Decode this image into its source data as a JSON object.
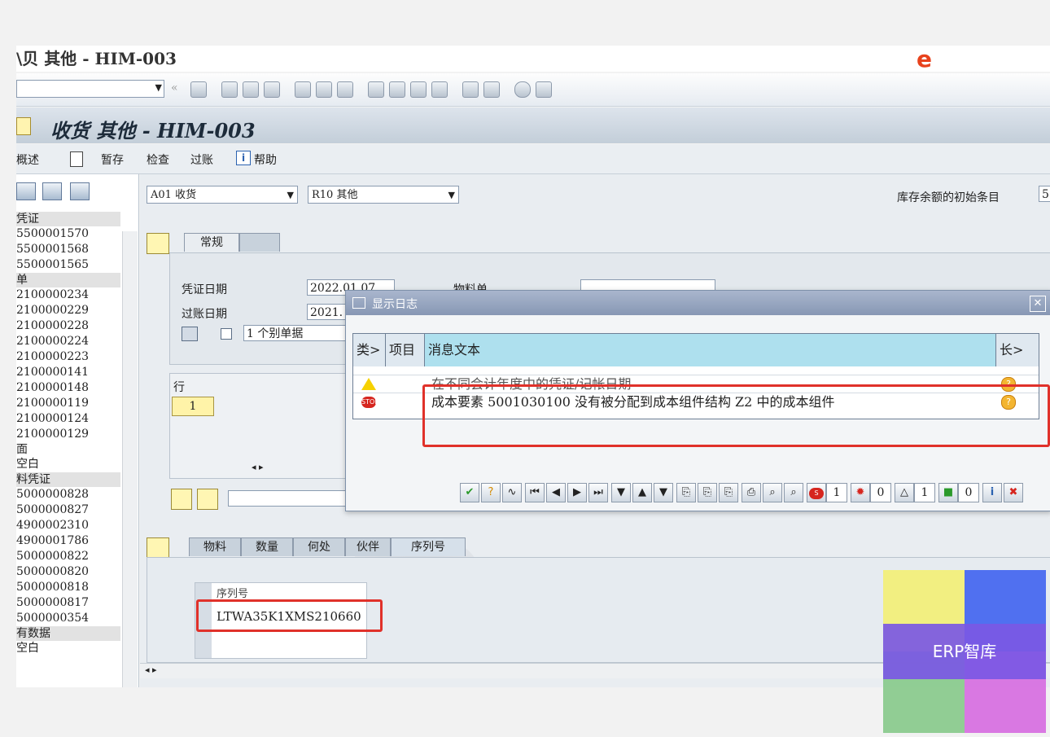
{
  "window": {
    "title": "收货 其他 - HIM-003",
    "top_cut_text": "\\贝 其他 - HIM-003"
  },
  "app_toolbar": {
    "overview": "概述",
    "hold": "暂存",
    "check": "检查",
    "post": "过账",
    "help": "帮助"
  },
  "nav": {
    "sec1": "凭证",
    "items1": [
      "5500001570",
      "5500001568",
      "5500001565"
    ],
    "sec2": "单",
    "items2": [
      "2100000234",
      "2100000229",
      "2100000228",
      "2100000224",
      "2100000223",
      "2100000141",
      "2100000148",
      "2100000119",
      "2100000124",
      "2100000129"
    ],
    "sec3": "面",
    "item3": "空白",
    "sec4": "料凭证",
    "items4": [
      "5000000828",
      "5000000827",
      "4900002310",
      "4900001786",
      "5000000822",
      "5000000820",
      "5000000818",
      "5000000817",
      "5000000354"
    ],
    "sec5": "有数据",
    "item5": "空白"
  },
  "header": {
    "transaction": "A01 收货",
    "movement": "R10 其他",
    "right_label": "库存余额的初始条目",
    "right_value": "5"
  },
  "tabs_top": {
    "general": "常规"
  },
  "general": {
    "doc_date_label": "凭证日期",
    "doc_date": "2022.01.07",
    "post_date_label": "过账日期",
    "post_date": "2021.",
    "delivery_note_label": "物料单",
    "slip_label": "1 个别单据"
  },
  "items": {
    "row_header": "行",
    "row1": "1"
  },
  "tabs_bottom": {
    "material": "物料",
    "quantity": "数量",
    "where": "何处",
    "partner": "伙伴",
    "serial": "序列号"
  },
  "serial": {
    "header": "序列号",
    "value": "LTWA35K1XMS210660"
  },
  "dialog": {
    "title": "显示日志",
    "col_type": "类>",
    "col_item": "项目",
    "col_msg": "消息文本",
    "col_long": "长>",
    "rows": [
      {
        "msg": "在不同会计年度中的凭证/记帐日期"
      },
      {
        "msg": "成本要素 5001030100 没有被分配到成本组件结构 Z2 中的成本组件"
      }
    ],
    "count_error": "1",
    "count_stop": "0",
    "count_warn": "1",
    "count_info": "0"
  },
  "watermark": {
    "text": "ERP智库"
  },
  "colors": {
    "highlight_red": "#e0312a",
    "dialog_header": "#aee0ee",
    "title_bar": "#c3ced9"
  }
}
